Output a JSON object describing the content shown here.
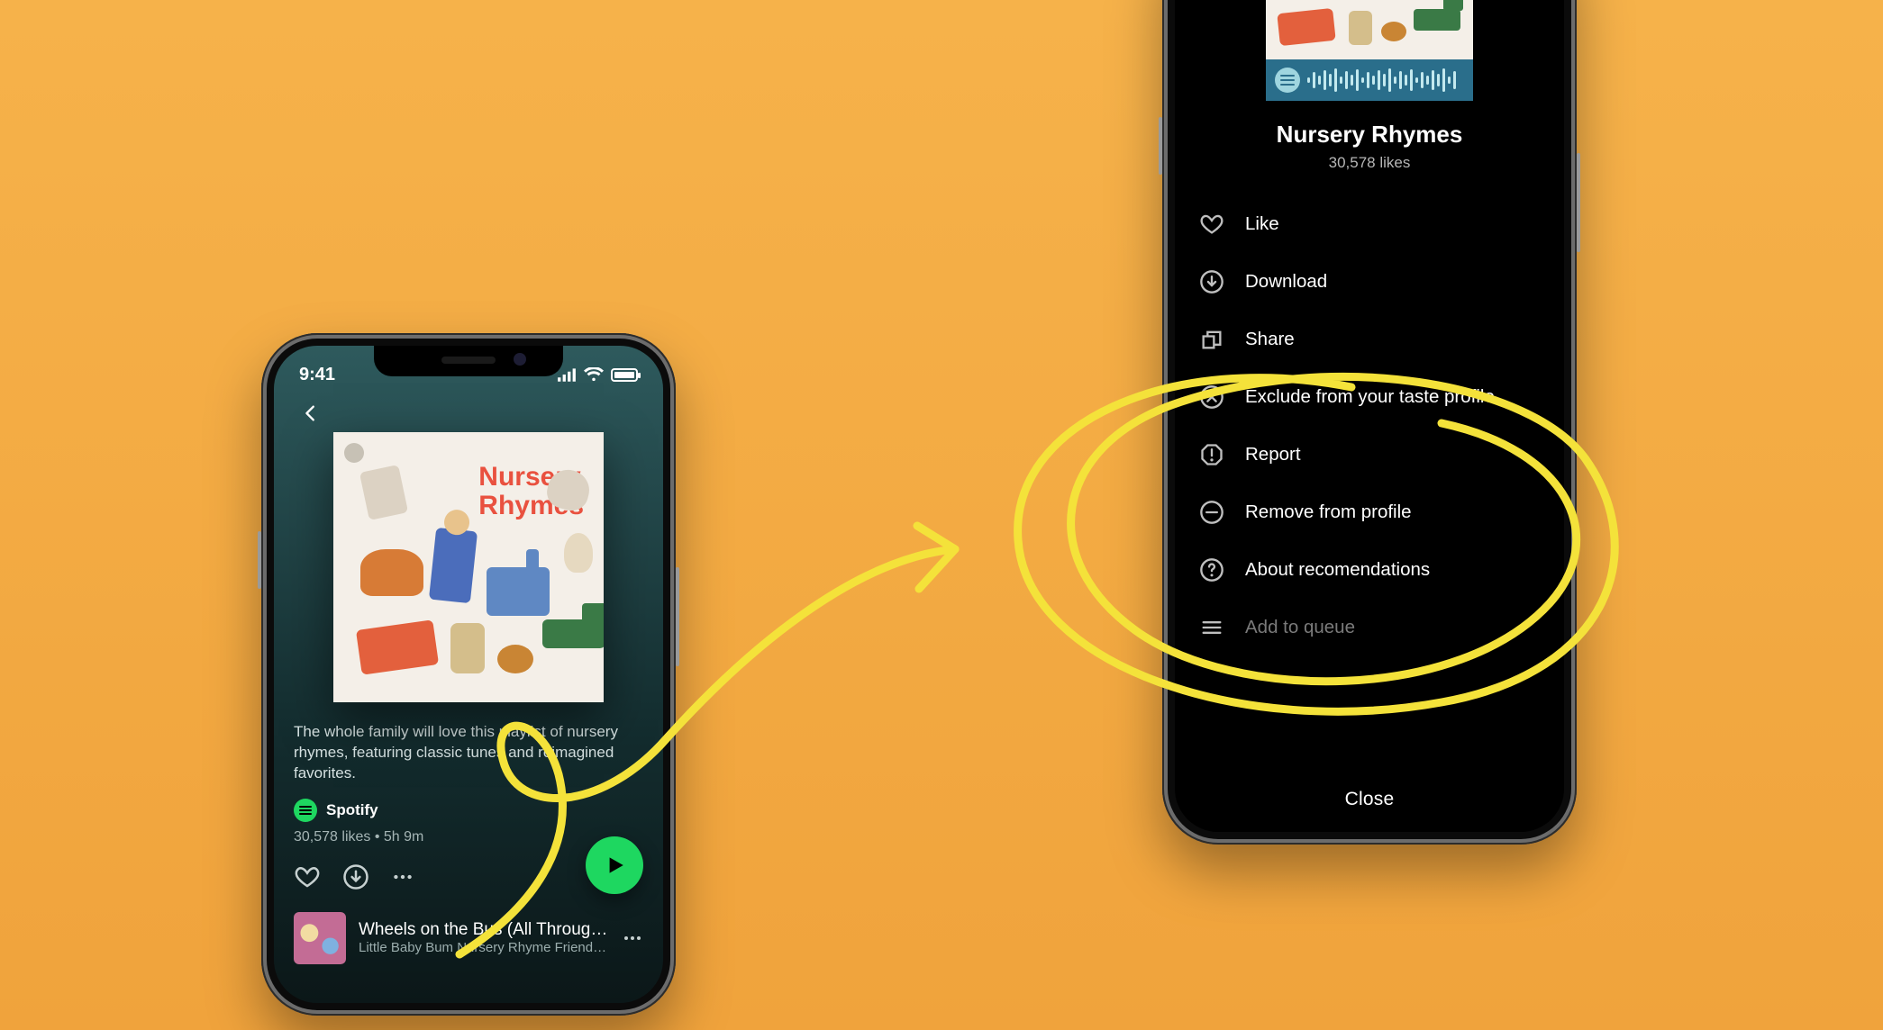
{
  "colors": {
    "accent_green": "#1ed760",
    "background_orange": "#f0a33c",
    "annotation_yellow": "#f4e23a"
  },
  "status_bar": {
    "time": "9:41"
  },
  "playlist": {
    "cover_title_line1": "Nursery",
    "cover_title_line2": "Rhymes",
    "description": "The whole family will love this playlist of nursery rhymes, featuring classic tunes and reimagined favorites.",
    "owner": "Spotify",
    "likes": "30,578 likes",
    "duration": "5h 9m",
    "meta_separator": " • ",
    "track": {
      "title": "Wheels on the Bus (All Through t…",
      "subtitle": "Little Baby Bum Nursery Rhyme Friends • …"
    }
  },
  "sheet": {
    "title": "Nursery Rhymes",
    "likes": "30,578 likes",
    "close_label": "Close",
    "items": [
      {
        "icon": "heart",
        "label": "Like"
      },
      {
        "icon": "download",
        "label": "Download"
      },
      {
        "icon": "share",
        "label": "Share"
      },
      {
        "icon": "exclude",
        "label": "Exclude from your taste profile"
      },
      {
        "icon": "report",
        "label": "Report"
      },
      {
        "icon": "remove",
        "label": "Remove from profile"
      },
      {
        "icon": "about",
        "label": "About recomendations"
      },
      {
        "icon": "queue",
        "label": "Add to queue"
      }
    ]
  },
  "code_bar_heights": [
    6,
    18,
    10,
    22,
    14,
    26,
    8,
    20,
    12,
    24,
    6,
    18,
    10,
    22,
    14,
    26,
    8,
    20,
    12,
    24,
    6,
    18,
    10,
    22,
    14,
    26,
    8,
    20
  ]
}
